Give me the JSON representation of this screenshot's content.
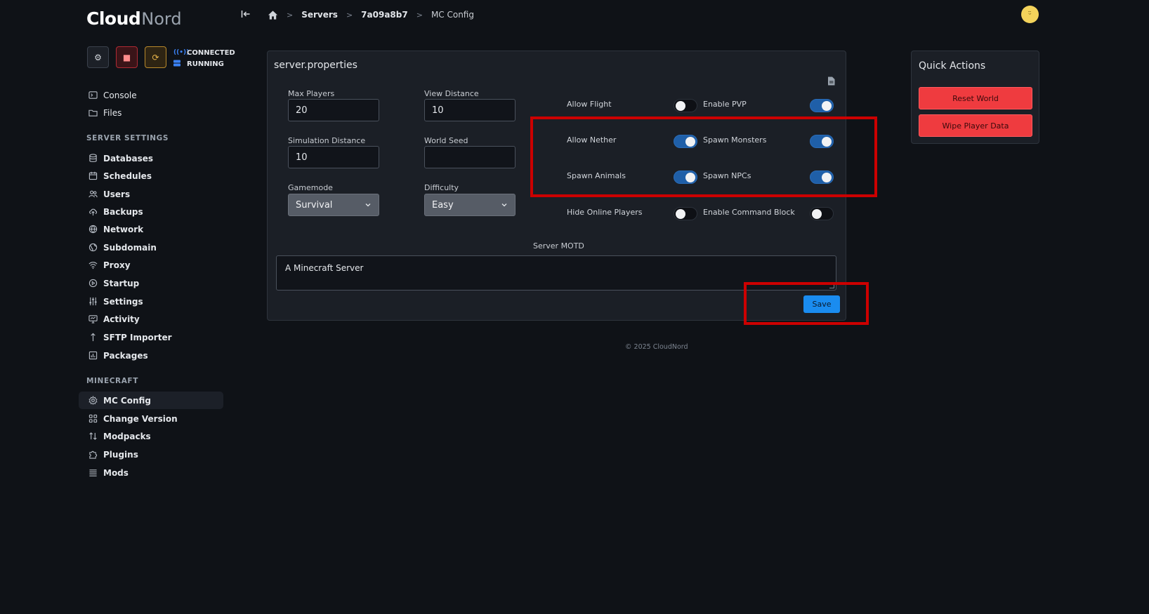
{
  "brand": {
    "logo_primary": "Cloud",
    "logo_secondary": "Nord"
  },
  "power": {
    "gear_icon": "⚙",
    "stop_icon": "■",
    "restart_icon": "⟳"
  },
  "status": {
    "connection": "CONNECTED",
    "state": "RUNNING"
  },
  "nav": {
    "top": [
      {
        "label": "Console",
        "icon": "terminal-icon"
      },
      {
        "label": "Files",
        "icon": "folder-icon"
      }
    ],
    "server_settings_title": "SERVER SETTINGS",
    "server_settings": [
      {
        "label": "Databases",
        "icon": "database-icon"
      },
      {
        "label": "Schedules",
        "icon": "calendar-icon"
      },
      {
        "label": "Users",
        "icon": "users-icon"
      },
      {
        "label": "Backups",
        "icon": "cloud-upload-icon"
      },
      {
        "label": "Network",
        "icon": "globe-icon"
      },
      {
        "label": "Subdomain",
        "icon": "globe-alt-icon"
      },
      {
        "label": "Proxy",
        "icon": "wifi-icon"
      },
      {
        "label": "Startup",
        "icon": "play-circle-icon"
      },
      {
        "label": "Settings",
        "icon": "sliders-icon"
      },
      {
        "label": "Activity",
        "icon": "monitor-icon"
      },
      {
        "label": "SFTP Importer",
        "icon": "arrow-up-icon"
      },
      {
        "label": "Packages",
        "icon": "chart-box-icon"
      }
    ],
    "minecraft_title": "MINECRAFT",
    "minecraft": [
      {
        "label": "MC Config",
        "icon": "gear-icon"
      },
      {
        "label": "Change Version",
        "icon": "grid-icon"
      },
      {
        "label": "Modpacks",
        "icon": "sort-arrows-icon"
      },
      {
        "label": "Plugins",
        "icon": "puzzle-icon"
      },
      {
        "label": "Mods",
        "icon": "list-icon"
      }
    ]
  },
  "breadcrumb": {
    "servers": "Servers",
    "server_id": "7a09a8b7",
    "current": "MC Config"
  },
  "avatar": {
    "glyph": "ᵕ̈"
  },
  "properties": {
    "title": "server.properties",
    "max_players_label": "Max Players",
    "max_players_value": "20",
    "view_distance_label": "View Distance",
    "view_distance_value": "10",
    "simulation_distance_label": "Simulation Distance",
    "simulation_distance_value": "10",
    "world_seed_label": "World Seed",
    "world_seed_value": "",
    "gamemode_label": "Gamemode",
    "gamemode_value": "Survival",
    "difficulty_label": "Difficulty",
    "difficulty_value": "Easy",
    "toggles": [
      {
        "label": "Allow Flight",
        "on": false
      },
      {
        "label": "Enable PVP",
        "on": true
      },
      {
        "label": "Allow Nether",
        "on": true
      },
      {
        "label": "Spawn Monsters",
        "on": true
      },
      {
        "label": "Spawn Animals",
        "on": true
      },
      {
        "label": "Spawn NPCs",
        "on": true
      },
      {
        "label": "Hide Online Players",
        "on": false
      },
      {
        "label": "Enable Command Block",
        "on": false
      }
    ],
    "motd_label": "Server MOTD",
    "motd_value": "A Minecraft Server",
    "save_label": "Save"
  },
  "quick_actions": {
    "title": "Quick Actions",
    "reset_world": "Reset World",
    "wipe_player_data": "Wipe Player Data"
  },
  "footer": {
    "copyright": "© 2025 CloudNord"
  },
  "colors": {
    "annotation": "#cc0000",
    "accent": "#1a8cf0",
    "danger": "#ef3b3f"
  }
}
